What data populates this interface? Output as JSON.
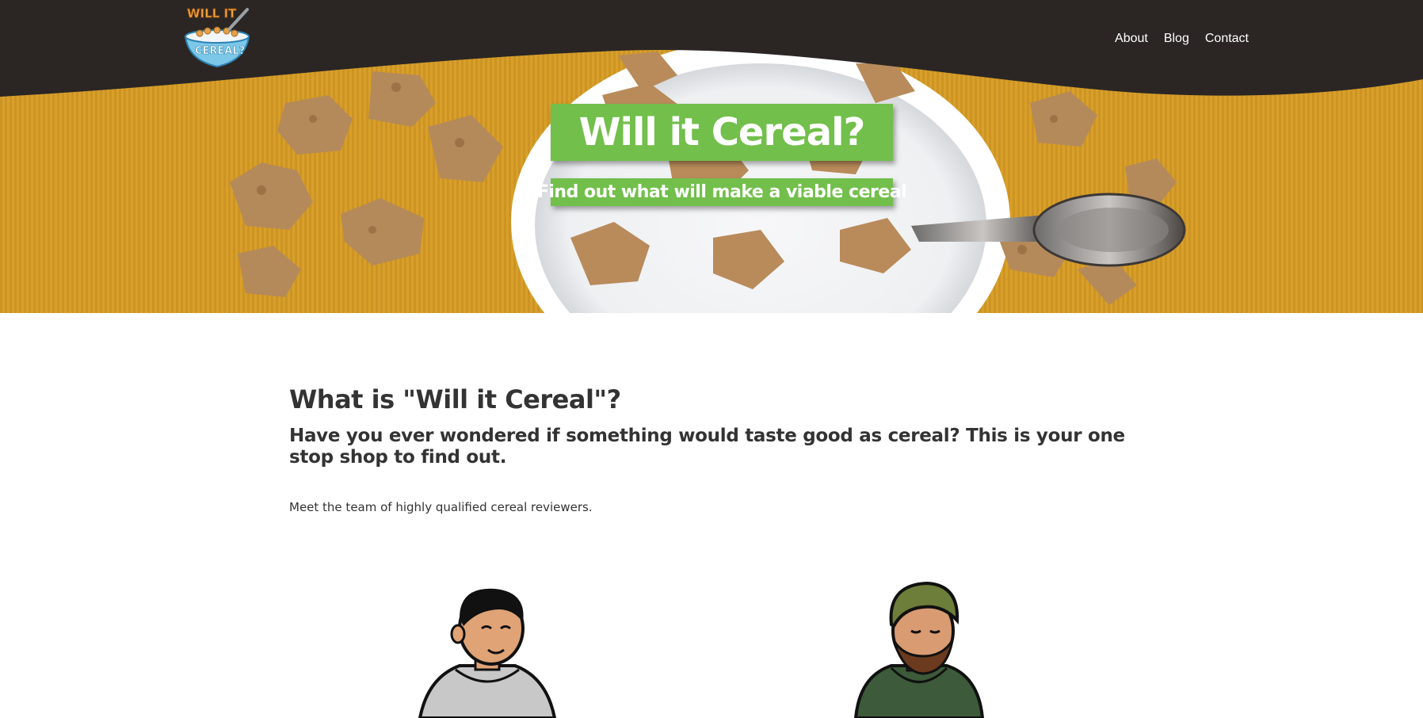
{
  "header": {
    "logo_text_line1": "WILL IT",
    "logo_text_line2": "CEREAL?",
    "nav": [
      {
        "label": "About"
      },
      {
        "label": "Blog"
      },
      {
        "label": "Contact"
      }
    ]
  },
  "hero": {
    "title": "Will it Cereal?",
    "subtitle": "Find out what will make a viable cereal"
  },
  "main": {
    "heading": "What is \"Will it Cereal\"?",
    "subheading": "Have you ever wondered if something would taste good as cereal? This is your one stop shop to find out.",
    "team_intro": "Meet the team of highly qualified cereal reviewers."
  },
  "colors": {
    "topbar": "#2b2624",
    "accent_green": "#72bf4b",
    "table_yellow": "#d9a12a"
  }
}
